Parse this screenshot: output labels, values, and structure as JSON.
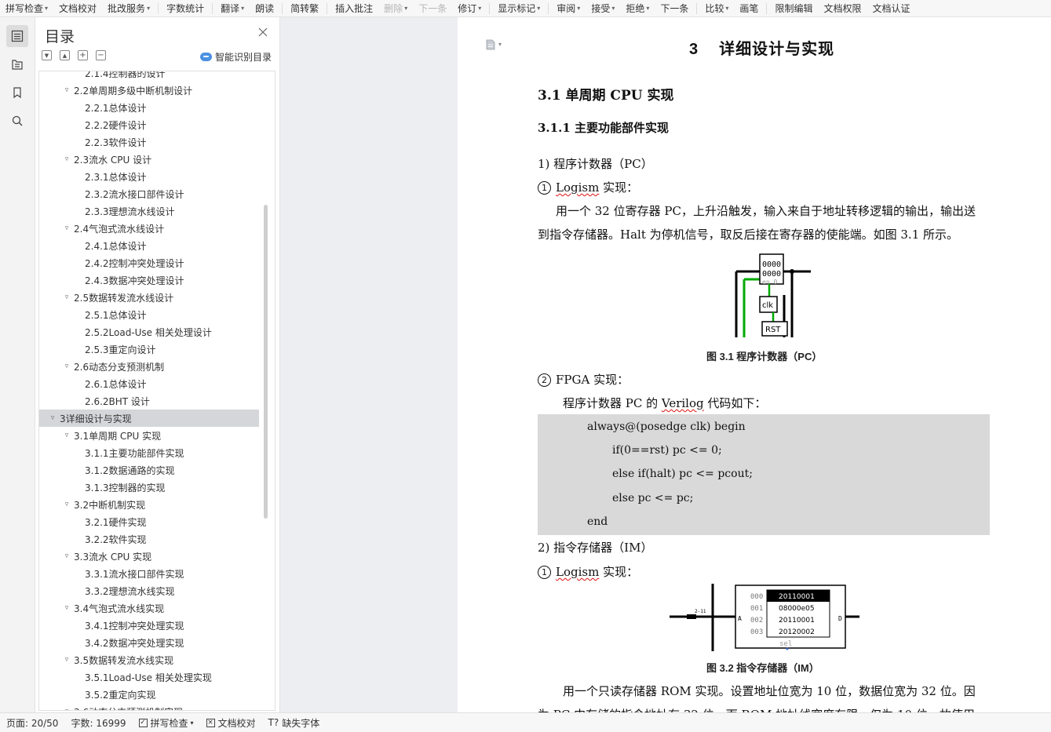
{
  "toolbar": {
    "items": [
      {
        "label": "拼写检查",
        "caret": true,
        "disabled": false
      },
      {
        "label": "文档校对",
        "caret": false,
        "disabled": false
      },
      {
        "label": "批改服务",
        "caret": true,
        "disabled": false
      },
      {
        "label": "字数统计",
        "caret": false,
        "disabled": false
      },
      {
        "label": "翻译",
        "caret": true,
        "disabled": false
      },
      {
        "label": "朗读",
        "caret": false,
        "disabled": false
      },
      {
        "label": "简转繁",
        "caret": false,
        "disabled": false
      },
      {
        "label": "插入批注",
        "caret": false,
        "disabled": false
      },
      {
        "label": "删除",
        "caret": true,
        "disabled": true
      },
      {
        "label": "下一条",
        "caret": false,
        "disabled": true
      },
      {
        "label": "修订",
        "caret": true,
        "disabled": false
      },
      {
        "label": "显示标记",
        "caret": true,
        "disabled": false
      },
      {
        "label": "审阅",
        "caret": true,
        "disabled": false
      },
      {
        "label": "接受",
        "caret": true,
        "disabled": false
      },
      {
        "label": "拒绝",
        "caret": true,
        "disabled": false
      },
      {
        "label": "下一条",
        "caret": false,
        "disabled": false
      },
      {
        "label": "比较",
        "caret": true,
        "disabled": false
      },
      {
        "label": "画笔",
        "caret": false,
        "disabled": false
      },
      {
        "label": "限制编辑",
        "caret": false,
        "disabled": false
      },
      {
        "label": "文档权限",
        "caret": false,
        "disabled": false
      },
      {
        "label": "文档认证",
        "caret": false,
        "disabled": false
      }
    ]
  },
  "toc": {
    "title": "目录",
    "smart_label": "智能识别目录",
    "items": [
      {
        "level": 3,
        "text": "2.1.4控制器的设计",
        "expand": ""
      },
      {
        "level": 2,
        "text": "2.2单周期多级中断机制设计",
        "expand": "▿"
      },
      {
        "level": 3,
        "text": "2.2.1总体设计",
        "expand": ""
      },
      {
        "level": 3,
        "text": "2.2.2硬件设计",
        "expand": ""
      },
      {
        "level": 3,
        "text": "2.2.3软件设计",
        "expand": ""
      },
      {
        "level": 2,
        "text": "2.3流水 CPU 设计",
        "expand": "▿"
      },
      {
        "level": 3,
        "text": "2.3.1总体设计",
        "expand": ""
      },
      {
        "level": 3,
        "text": "2.3.2流水接口部件设计",
        "expand": ""
      },
      {
        "level": 3,
        "text": "2.3.3理想流水线设计",
        "expand": ""
      },
      {
        "level": 2,
        "text": "2.4气泡式流水线设计",
        "expand": "▿"
      },
      {
        "level": 3,
        "text": "2.4.1总体设计",
        "expand": ""
      },
      {
        "level": 3,
        "text": "2.4.2控制冲突处理设计",
        "expand": ""
      },
      {
        "level": 3,
        "text": "2.4.3数据冲突处理设计",
        "expand": ""
      },
      {
        "level": 2,
        "text": "2.5数据转发流水线设计",
        "expand": "▿"
      },
      {
        "level": 3,
        "text": "2.5.1总体设计",
        "expand": ""
      },
      {
        "level": 3,
        "text": "2.5.2Load-Use 相关处理设计",
        "expand": ""
      },
      {
        "level": 3,
        "text": "2.5.3重定向设计",
        "expand": ""
      },
      {
        "level": 2,
        "text": "2.6动态分支预测机制",
        "expand": "▿"
      },
      {
        "level": 3,
        "text": "2.6.1总体设计",
        "expand": ""
      },
      {
        "level": 3,
        "text": "2.6.2BHT 设计",
        "expand": ""
      },
      {
        "level": 1,
        "text": "3详细设计与实现",
        "expand": "▿",
        "selected": true
      },
      {
        "level": 2,
        "text": "3.1单周期 CPU  实现",
        "expand": "▿"
      },
      {
        "level": 3,
        "text": "3.1.1主要功能部件实现",
        "expand": ""
      },
      {
        "level": 3,
        "text": "3.1.2数据通路的实现",
        "expand": ""
      },
      {
        "level": 3,
        "text": "3.1.3控制器的实现",
        "expand": ""
      },
      {
        "level": 2,
        "text": "3.2中断机制实现",
        "expand": "▿"
      },
      {
        "level": 3,
        "text": "3.2.1硬件实现",
        "expand": ""
      },
      {
        "level": 3,
        "text": "3.2.2软件实现",
        "expand": ""
      },
      {
        "level": 2,
        "text": "3.3流水 CPU 实现",
        "expand": "▿"
      },
      {
        "level": 3,
        "text": "3.3.1流水接口部件实现",
        "expand": ""
      },
      {
        "level": 3,
        "text": "3.3.2理想流水线实现",
        "expand": ""
      },
      {
        "level": 2,
        "text": "3.4气泡式流水线实现",
        "expand": "▿"
      },
      {
        "level": 3,
        "text": "3.4.1控制冲突处理实现",
        "expand": ""
      },
      {
        "level": 3,
        "text": "3.4.2数据冲突处理实现",
        "expand": ""
      },
      {
        "level": 2,
        "text": "3.5数据转发流水线实现",
        "expand": "▿"
      },
      {
        "level": 3,
        "text": "3.5.1Load-Use 相关处理实现",
        "expand": ""
      },
      {
        "level": 3,
        "text": "3.5.2重定向实现",
        "expand": ""
      },
      {
        "level": 2,
        "text": "3.6动态分支预测机制实现",
        "expand": "▿"
      }
    ]
  },
  "doc": {
    "chapter_num": "3",
    "chapter_title": "详细设计与实现",
    "section": "3.1   单周期 CPU  实现",
    "subsection": "3.1.1    主要功能部件实现",
    "item1": "1)  程序计数器（PC）",
    "item1_a_num": "1",
    "item1_a_word": "Logism",
    "item1_a_rest": " 实现：",
    "para1_line1": "用一个 32 位寄存器 PC，上升沿触发，输入来自于地址转移逻辑的输出，输出送",
    "para1_line2": "到指令存储器。Halt 为停机信号，取反后接在寄存器的使能端。如图  3.1 所示。",
    "fig1": {
      "reg_top": "0000",
      "reg_bottom": "0000",
      "en": "en 0",
      "clk": "clk",
      "rst": "RST",
      "caption": "图  3.1  程序计数器（PC）"
    },
    "item1_b_num": "2",
    "item1_b_text": "FPGA 实现：",
    "para2_pre": "程序计数器 PC 的 ",
    "para2_word": "Verilog",
    "para2_post": " 代码如下：",
    "code": {
      "l1": "always@(posedge clk) begin",
      "l2": "if(0==rst) pc <= 0;",
      "l3": "else if(halt)    pc <= pcout;",
      "l4": "else    pc <= pc;",
      "l5": "end"
    },
    "item2": "2)  指令存储器（IM）",
    "item2_a_num": "1",
    "item2_a_word": "Logism",
    "item2_a_rest": " 实现：",
    "fig2": {
      "addrs": [
        "000",
        "001",
        "002",
        "003"
      ],
      "words": [
        "20110001",
        "08000e05",
        "20110001",
        "20120002"
      ],
      "port_a": "A",
      "port_d": "D",
      "sel": "sel",
      "bus": "2-11",
      "caption": "图  3.2  指令存储器（IM）"
    },
    "para3_line1": "用一个只读存储器 ROM 实现。设置地址位宽为 10 位，数据位宽为 32 位。因",
    "para3_line2": "为 PC 中存储的指令地址有 32 位，而 ROM 地址线宽度有限，仅为 10 位，故使用"
  },
  "status": {
    "page": "页面: 20/50",
    "words": "字数: 16999",
    "spell": "拼写检查",
    "proof": "文档校对",
    "font": "缺失字体"
  },
  "colors": {
    "selected_toc": "#d4d6da",
    "gutter": "#eceef1",
    "wire_green": "#00aa00",
    "code_bg": "#d9d9d9"
  }
}
